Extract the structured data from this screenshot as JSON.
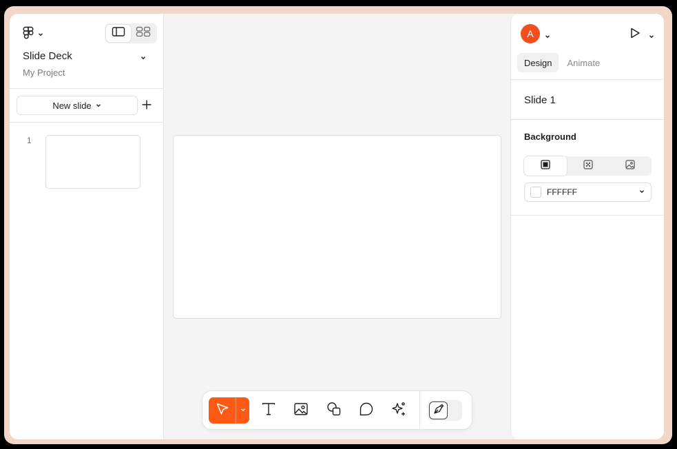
{
  "sidebar": {
    "deck_title": "Slide Deck",
    "project_name": "My Project",
    "new_slide_label": "New slide",
    "slides": [
      {
        "number": "1"
      }
    ]
  },
  "panel": {
    "avatar_initial": "A",
    "tabs": [
      {
        "label": "Design",
        "active": true
      },
      {
        "label": "Animate",
        "active": false
      }
    ],
    "selected_slide": "Slide 1",
    "background": {
      "label": "Background",
      "types": [
        "solid-fill-icon",
        "pattern-fill-icon",
        "image-fill-icon"
      ],
      "color_value": "FFFFFF",
      "color_hex": "#FFFFFF"
    }
  },
  "toolbar": {
    "tools": [
      "select-arrow-icon",
      "text-icon",
      "image-icon",
      "shapes-icon",
      "comment-icon",
      "ai-sparkle-icon",
      "pen-mode-icon"
    ]
  },
  "colors": {
    "accent": "#FF5A13",
    "avatar": "#F24E1E"
  }
}
